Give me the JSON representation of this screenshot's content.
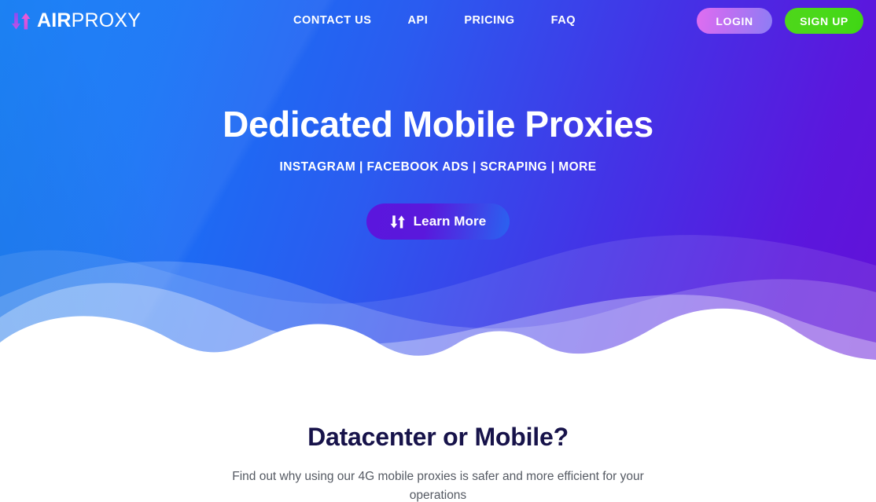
{
  "brand": {
    "name_bold": "AIR",
    "name_light": "PROXY",
    "icon": "updown-arrows-icon",
    "icon_color_down": "#9b4ff0",
    "icon_color_up": "#e054d9"
  },
  "nav": {
    "links": [
      {
        "label": "CONTACT US",
        "name": "nav-link-contact-us"
      },
      {
        "label": "API",
        "name": "nav-link-api"
      },
      {
        "label": "PRICING",
        "name": "nav-link-pricing"
      },
      {
        "label": "FAQ",
        "name": "nav-link-faq"
      }
    ],
    "login_label": "LOGIN",
    "signup_label": "SIGN UP",
    "login_gradient": [
      "#e06ef0",
      "#8d7df4"
    ],
    "signup_gradient": [
      "#4ed61b",
      "#3fd614"
    ]
  },
  "hero": {
    "title": "Dedicated Mobile Proxies",
    "subtitle": "INSTAGRAM | FACEBOOK ADS | SCRAPING | MORE",
    "cta_label": "Learn More",
    "cta_icon": "updown-arrows-icon",
    "background_gradient": [
      "#0f7cf7",
      "#5b17dd"
    ]
  },
  "section": {
    "title": "Datacenter or Mobile?",
    "description": "Find out why using our 4G mobile proxies is safer and more efficient for your operations",
    "title_color": "#17134a"
  }
}
